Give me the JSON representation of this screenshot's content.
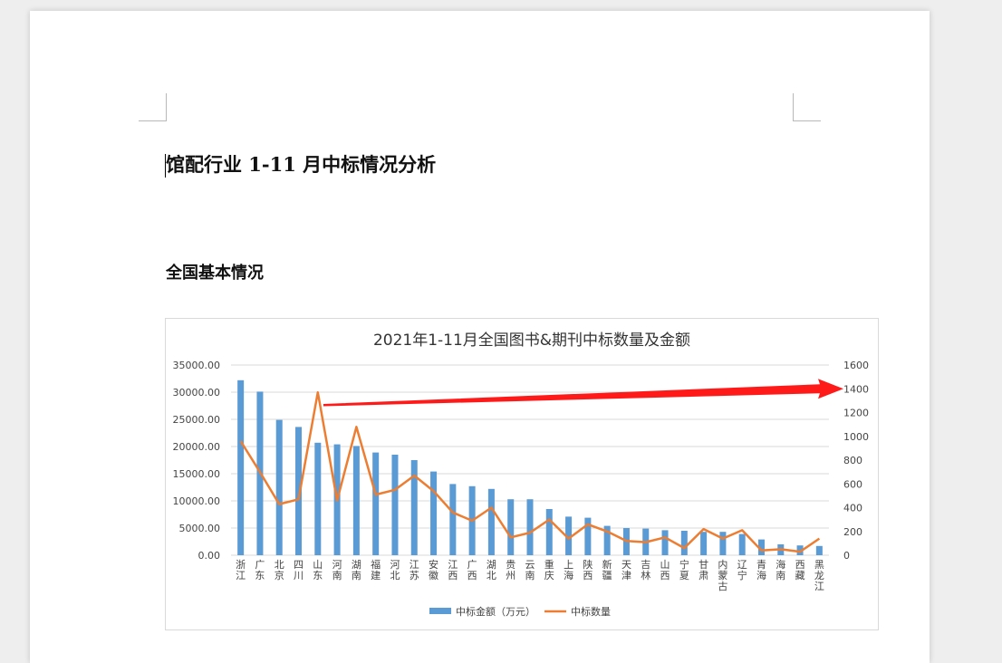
{
  "document": {
    "title": "馆配行业 1-11 月中标情况分析",
    "section_heading": "全国基本情况"
  },
  "colors": {
    "bar": "#5b9bd5",
    "line": "#ed7d31",
    "arrow": "#ff1a1a",
    "grid": "#d9d9d9"
  },
  "chart_data": {
    "type": "bar",
    "title": "2021年1-11月全国图书&期刊中标数量及金额",
    "categories": [
      "浙江",
      "广东",
      "北京",
      "四川",
      "山东",
      "河南",
      "湖南",
      "福建",
      "河北",
      "江苏",
      "安徽",
      "江西",
      "广西",
      "湖北",
      "贵州",
      "云南",
      "重庆",
      "上海",
      "陕西",
      "新疆",
      "天津",
      "吉林",
      "山西",
      "宁夏",
      "甘肃",
      "内蒙古",
      "辽宁",
      "青海",
      "海南",
      "西藏",
      "黑龙江"
    ],
    "series": [
      {
        "name": "中标金额（万元）",
        "type": "bar",
        "axis": "left",
        "values": [
          32200,
          30100,
          24900,
          23600,
          20700,
          20400,
          20100,
          18900,
          18500,
          17500,
          15400,
          13100,
          12700,
          12200,
          10300,
          10300,
          8500,
          7100,
          6900,
          5400,
          5000,
          4900,
          4600,
          4500,
          4300,
          4300,
          3900,
          2900,
          2000,
          1800,
          1700
        ]
      },
      {
        "name": "中标数量",
        "type": "line",
        "axis": "right",
        "values": [
          960,
          700,
          430,
          470,
          1370,
          460,
          1080,
          510,
          550,
          670,
          540,
          360,
          290,
          400,
          150,
          190,
          300,
          140,
          260,
          200,
          120,
          110,
          150,
          60,
          220,
          140,
          210,
          40,
          50,
          30,
          140
        ]
      }
    ],
    "y_left": {
      "min": 0,
      "max": 35000,
      "ticks": [
        "35000.00",
        "30000.00",
        "25000.00",
        "20000.00",
        "15000.00",
        "10000.00",
        "5000.00",
        "0.00"
      ]
    },
    "y_right": {
      "min": 0,
      "max": 1600,
      "ticks": [
        "1600",
        "1400",
        "1200",
        "1000",
        "800",
        "600",
        "400",
        "200",
        "0"
      ]
    },
    "grid": true,
    "legend_position": "bottom",
    "annotation": "red arrow pointing toward the 1400 level on the right axis"
  }
}
